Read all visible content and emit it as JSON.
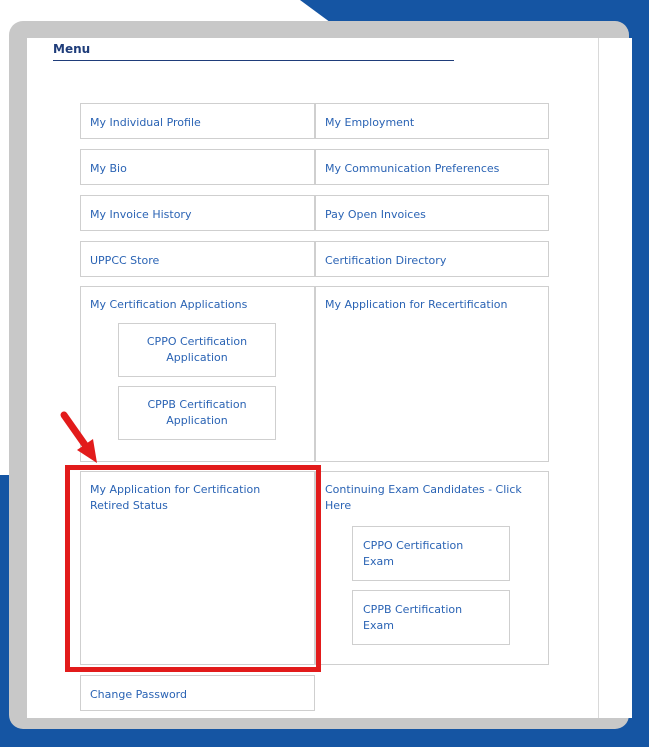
{
  "menu": {
    "title": "Menu",
    "items": {
      "individual_profile": "My Individual Profile",
      "employment": "My Employment",
      "bio": "My Bio",
      "communication_preferences": "My Communication Preferences",
      "invoice_history": "My Invoice History",
      "pay_open_invoices": "Pay Open Invoices",
      "uppcc_store": "UPPCC Store",
      "certification_directory": "Certification Directory",
      "certification_applications": "My Certification Applications",
      "recertification_application": "My Application for Recertification",
      "retired_status_application": "My Application for Certification Retired Status",
      "continuing_exam_candidates": "Continuing Exam Candidates - Click Here",
      "change_password": "Change Password"
    },
    "sub_items": {
      "cppo_certification_application": "CPPO Certification Application",
      "cppb_certification_application": "CPPB Certification Application",
      "cppo_certification_exam": "CPPO Certification Exam",
      "cppb_certification_exam": "CPPB Certification Exam"
    }
  },
  "colors": {
    "accent_blue": "#1555a3",
    "link_blue": "#2a63b4",
    "highlight_red": "#e21b1b"
  }
}
